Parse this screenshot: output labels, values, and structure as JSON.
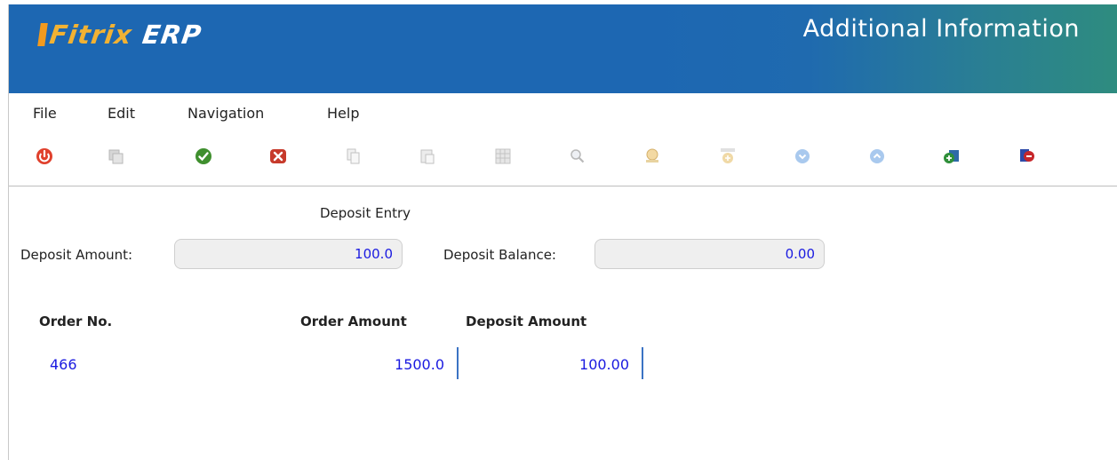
{
  "header": {
    "logo_text": "Fitrix",
    "logo_suffix": "ERP",
    "title": "Additional Information",
    "brand_color": "#1d67b2"
  },
  "menu": {
    "items": [
      {
        "label": "File"
      },
      {
        "label": "Edit"
      },
      {
        "label": "Navigation"
      },
      {
        "label": "Help"
      }
    ]
  },
  "toolbar": {
    "icons": [
      "power-icon",
      "copy-screen-icon",
      "accept-icon",
      "cancel-icon",
      "copy-icon",
      "paste-icon",
      "grid-icon",
      "zoom-icon",
      "lock-icon",
      "add-icon",
      "scroll-down-icon",
      "scroll-up-icon",
      "add-row-icon",
      "delete-row-icon"
    ]
  },
  "form": {
    "section_title": "Deposit Entry",
    "deposit_amount_label": "Deposit Amount:",
    "deposit_amount_value": "100.0",
    "deposit_balance_label": "Deposit Balance:",
    "deposit_balance_value": "0.00"
  },
  "table": {
    "headers": {
      "order_no": "Order No.",
      "order_amount": "Order Amount",
      "deposit_amount": "Deposit Amount"
    },
    "rows": [
      {
        "order_no": "466",
        "order_amount": "1500.0",
        "deposit_amount": "100.00"
      }
    ]
  }
}
